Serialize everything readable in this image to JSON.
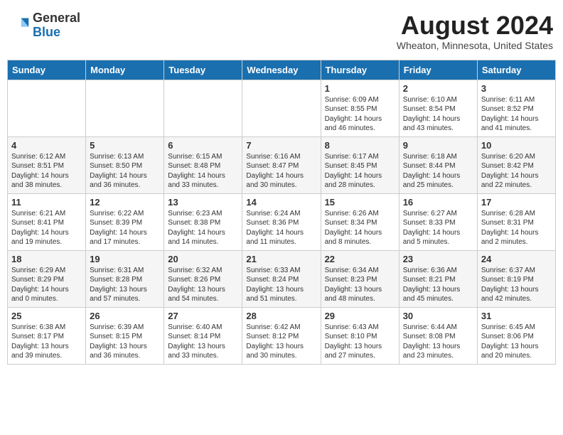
{
  "logo": {
    "general": "General",
    "blue": "Blue"
  },
  "header": {
    "month_year": "August 2024",
    "location": "Wheaton, Minnesota, United States"
  },
  "days_of_week": [
    "Sunday",
    "Monday",
    "Tuesday",
    "Wednesday",
    "Thursday",
    "Friday",
    "Saturday"
  ],
  "weeks": [
    [
      {
        "day": "",
        "text": ""
      },
      {
        "day": "",
        "text": ""
      },
      {
        "day": "",
        "text": ""
      },
      {
        "day": "",
        "text": ""
      },
      {
        "day": "1",
        "text": "Sunrise: 6:09 AM\nSunset: 8:55 PM\nDaylight: 14 hours and 46 minutes."
      },
      {
        "day": "2",
        "text": "Sunrise: 6:10 AM\nSunset: 8:54 PM\nDaylight: 14 hours and 43 minutes."
      },
      {
        "day": "3",
        "text": "Sunrise: 6:11 AM\nSunset: 8:52 PM\nDaylight: 14 hours and 41 minutes."
      }
    ],
    [
      {
        "day": "4",
        "text": "Sunrise: 6:12 AM\nSunset: 8:51 PM\nDaylight: 14 hours and 38 minutes."
      },
      {
        "day": "5",
        "text": "Sunrise: 6:13 AM\nSunset: 8:50 PM\nDaylight: 14 hours and 36 minutes."
      },
      {
        "day": "6",
        "text": "Sunrise: 6:15 AM\nSunset: 8:48 PM\nDaylight: 14 hours and 33 minutes."
      },
      {
        "day": "7",
        "text": "Sunrise: 6:16 AM\nSunset: 8:47 PM\nDaylight: 14 hours and 30 minutes."
      },
      {
        "day": "8",
        "text": "Sunrise: 6:17 AM\nSunset: 8:45 PM\nDaylight: 14 hours and 28 minutes."
      },
      {
        "day": "9",
        "text": "Sunrise: 6:18 AM\nSunset: 8:44 PM\nDaylight: 14 hours and 25 minutes."
      },
      {
        "day": "10",
        "text": "Sunrise: 6:20 AM\nSunset: 8:42 PM\nDaylight: 14 hours and 22 minutes."
      }
    ],
    [
      {
        "day": "11",
        "text": "Sunrise: 6:21 AM\nSunset: 8:41 PM\nDaylight: 14 hours and 19 minutes."
      },
      {
        "day": "12",
        "text": "Sunrise: 6:22 AM\nSunset: 8:39 PM\nDaylight: 14 hours and 17 minutes."
      },
      {
        "day": "13",
        "text": "Sunrise: 6:23 AM\nSunset: 8:38 PM\nDaylight: 14 hours and 14 minutes."
      },
      {
        "day": "14",
        "text": "Sunrise: 6:24 AM\nSunset: 8:36 PM\nDaylight: 14 hours and 11 minutes."
      },
      {
        "day": "15",
        "text": "Sunrise: 6:26 AM\nSunset: 8:34 PM\nDaylight: 14 hours and 8 minutes."
      },
      {
        "day": "16",
        "text": "Sunrise: 6:27 AM\nSunset: 8:33 PM\nDaylight: 14 hours and 5 minutes."
      },
      {
        "day": "17",
        "text": "Sunrise: 6:28 AM\nSunset: 8:31 PM\nDaylight: 14 hours and 2 minutes."
      }
    ],
    [
      {
        "day": "18",
        "text": "Sunrise: 6:29 AM\nSunset: 8:29 PM\nDaylight: 14 hours and 0 minutes."
      },
      {
        "day": "19",
        "text": "Sunrise: 6:31 AM\nSunset: 8:28 PM\nDaylight: 13 hours and 57 minutes."
      },
      {
        "day": "20",
        "text": "Sunrise: 6:32 AM\nSunset: 8:26 PM\nDaylight: 13 hours and 54 minutes."
      },
      {
        "day": "21",
        "text": "Sunrise: 6:33 AM\nSunset: 8:24 PM\nDaylight: 13 hours and 51 minutes."
      },
      {
        "day": "22",
        "text": "Sunrise: 6:34 AM\nSunset: 8:23 PM\nDaylight: 13 hours and 48 minutes."
      },
      {
        "day": "23",
        "text": "Sunrise: 6:36 AM\nSunset: 8:21 PM\nDaylight: 13 hours and 45 minutes."
      },
      {
        "day": "24",
        "text": "Sunrise: 6:37 AM\nSunset: 8:19 PM\nDaylight: 13 hours and 42 minutes."
      }
    ],
    [
      {
        "day": "25",
        "text": "Sunrise: 6:38 AM\nSunset: 8:17 PM\nDaylight: 13 hours and 39 minutes."
      },
      {
        "day": "26",
        "text": "Sunrise: 6:39 AM\nSunset: 8:15 PM\nDaylight: 13 hours and 36 minutes."
      },
      {
        "day": "27",
        "text": "Sunrise: 6:40 AM\nSunset: 8:14 PM\nDaylight: 13 hours and 33 minutes."
      },
      {
        "day": "28",
        "text": "Sunrise: 6:42 AM\nSunset: 8:12 PM\nDaylight: 13 hours and 30 minutes."
      },
      {
        "day": "29",
        "text": "Sunrise: 6:43 AM\nSunset: 8:10 PM\nDaylight: 13 hours and 27 minutes."
      },
      {
        "day": "30",
        "text": "Sunrise: 6:44 AM\nSunset: 8:08 PM\nDaylight: 13 hours and 23 minutes."
      },
      {
        "day": "31",
        "text": "Sunrise: 6:45 AM\nSunset: 8:06 PM\nDaylight: 13 hours and 20 minutes."
      }
    ]
  ]
}
